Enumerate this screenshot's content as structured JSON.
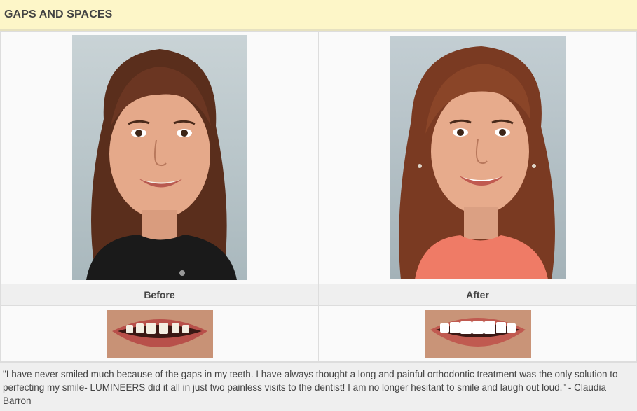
{
  "section": {
    "title": "GAPS AND SPACES"
  },
  "before": {
    "label": "Before",
    "portrait_desc": "woman-portrait-before",
    "teeth_desc": "teeth-closeup-gaps"
  },
  "after": {
    "label": "After",
    "portrait_desc": "woman-portrait-after",
    "teeth_desc": "teeth-closeup-veneers"
  },
  "testimonial": {
    "text": "\"I have never smiled much because of the gaps in my teeth. I have always thought a long and painful orthodontic treatment was the only solution to perfecting my smile- LUMINEERS did it all in just two painless visits to the dentist! I am no longer hesitant to smile and laugh out loud.\" - Claudia Barron"
  },
  "colors": {
    "header_bg": "#fdf6c8",
    "label_bg": "#efefef",
    "border": "#dddddd"
  }
}
